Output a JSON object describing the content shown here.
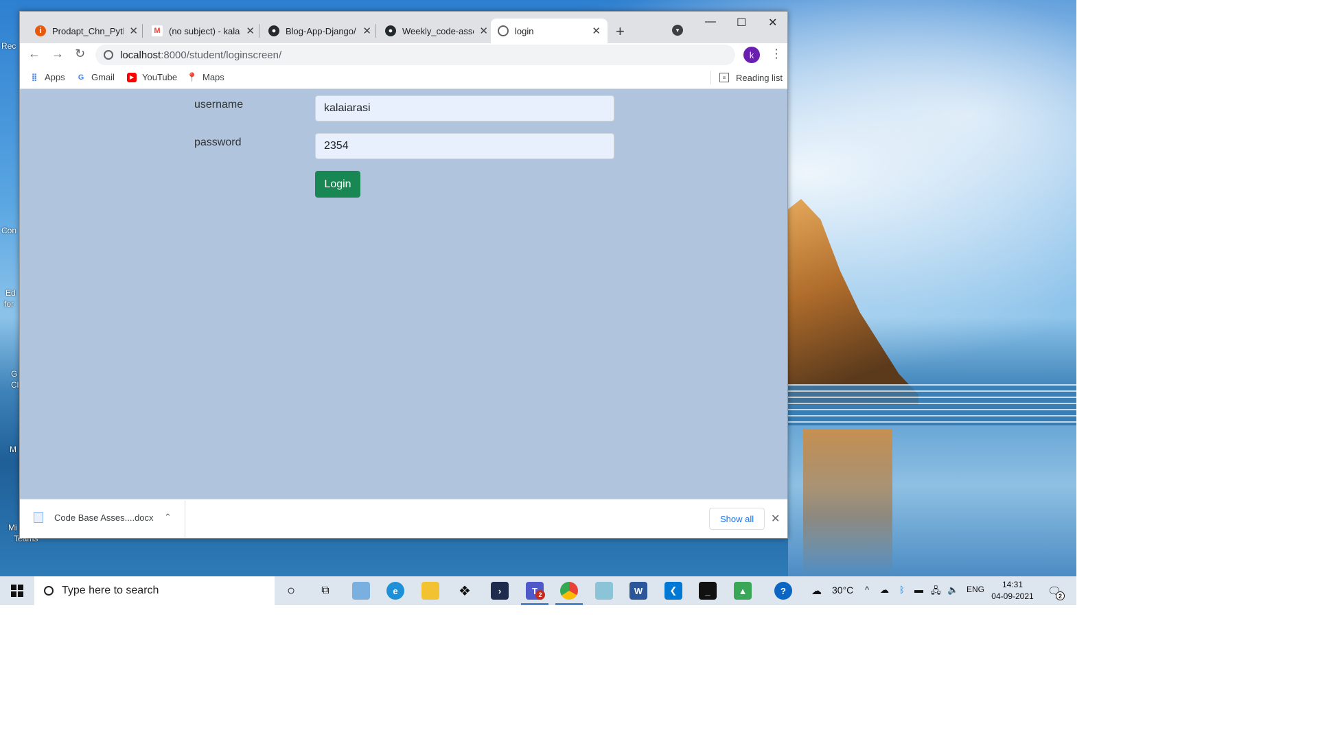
{
  "browser": {
    "tabs": [
      {
        "title": "Prodapt_Chn_Pytho",
        "icon": "orange-info-icon",
        "color": "#e8590c"
      },
      {
        "title": "(no subject) - kalai.",
        "icon": "gmail-icon",
        "color": "#ea4335"
      },
      {
        "title": "Blog-App-Django/",
        "icon": "github-icon",
        "color": "#24292e"
      },
      {
        "title": "Weekly_code-asse",
        "icon": "github-icon",
        "color": "#24292e"
      },
      {
        "title": "login",
        "icon": "globe-icon",
        "color": "#5f6368",
        "active": true
      }
    ],
    "url_host": "localhost",
    "url_path": ":8000/student/loginscreen/",
    "profile_initial": "k",
    "bookmarks": [
      {
        "label": "Apps",
        "icon": "apps-grid-icon"
      },
      {
        "label": "Gmail",
        "icon": "google-g-icon"
      },
      {
        "label": "YouTube",
        "icon": "youtube-icon"
      },
      {
        "label": "Maps",
        "icon": "maps-pin-icon"
      }
    ],
    "reading_list": "Reading list"
  },
  "page": {
    "username_label": "username",
    "username_value": "kalaiarasi",
    "password_label": "password",
    "password_value": "2354",
    "login_button": "Login",
    "background": "#b0c4de",
    "button_color": "#198754"
  },
  "downloads": {
    "file_name": "Code Base Asses....docx",
    "show_all": "Show all"
  },
  "taskbar": {
    "search_placeholder": "Type here to search",
    "teams_badge": "2",
    "temperature": "30°C",
    "language": "ENG",
    "time": "14:31",
    "date": "04-09-2021",
    "notification_badge": "2"
  },
  "desktop": {
    "icon_labels": [
      "Rec",
      "Con",
      "Ed",
      "for",
      "G",
      "Cl",
      "M",
      "Mi",
      "Teams"
    ]
  }
}
